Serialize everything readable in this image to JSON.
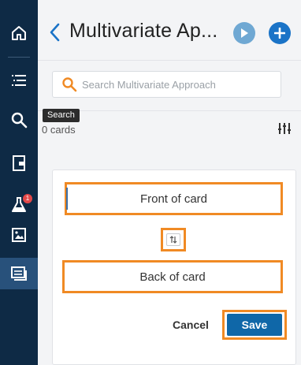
{
  "sidebar": {
    "items": [
      {
        "icon": "home-icon"
      },
      {
        "icon": "list-icon"
      },
      {
        "icon": "search-icon"
      },
      {
        "icon": "document-icon"
      },
      {
        "icon": "flask-icon",
        "badge": "1"
      },
      {
        "icon": "image-icon"
      },
      {
        "icon": "flashcards-icon",
        "active": true
      }
    ]
  },
  "tooltip": "Search",
  "header": {
    "title": "Multivariate Ap...",
    "back_icon": "chevron-left-icon",
    "play_icon": "play-icon",
    "add_icon": "plus-icon"
  },
  "search": {
    "placeholder": "Search Multivariate Approach",
    "value": ""
  },
  "cards": {
    "count_label": "0 cards",
    "filter_icon": "sliders-icon"
  },
  "editor": {
    "front_label": "Front of card",
    "back_label": "Back of card",
    "swap_icon": "swap-icon",
    "cancel_label": "Cancel",
    "save_label": "Save"
  },
  "colors": {
    "sidebar": "#0e2a45",
    "sidebar_active": "#28517b",
    "accent_blue": "#1a73c7",
    "save_blue": "#0f67a8",
    "highlight_orange": "#f08a24",
    "badge_red": "#e24848"
  }
}
